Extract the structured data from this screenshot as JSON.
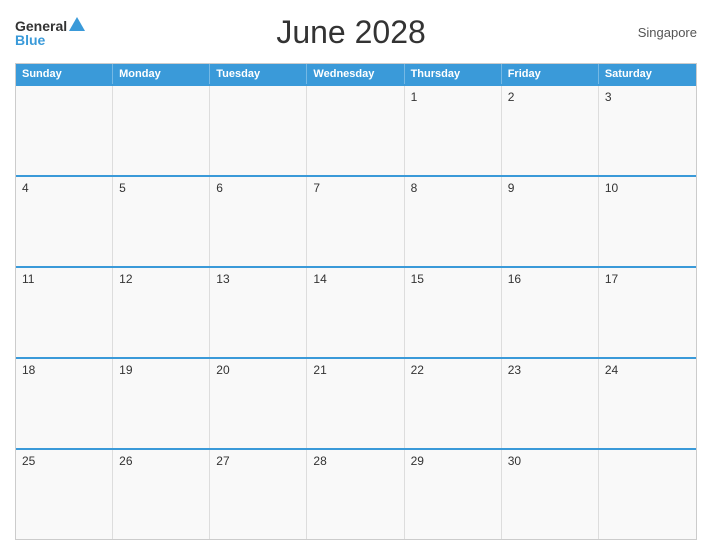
{
  "header": {
    "logo_general": "General",
    "logo_blue": "Blue",
    "title": "June 2028",
    "region": "Singapore"
  },
  "calendar": {
    "days_of_week": [
      "Sunday",
      "Monday",
      "Tuesday",
      "Wednesday",
      "Thursday",
      "Friday",
      "Saturday"
    ],
    "weeks": [
      [
        {
          "day": ""
        },
        {
          "day": ""
        },
        {
          "day": ""
        },
        {
          "day": ""
        },
        {
          "day": "1"
        },
        {
          "day": "2"
        },
        {
          "day": "3"
        }
      ],
      [
        {
          "day": "4"
        },
        {
          "day": "5"
        },
        {
          "day": "6"
        },
        {
          "day": "7"
        },
        {
          "day": "8"
        },
        {
          "day": "9"
        },
        {
          "day": "10"
        }
      ],
      [
        {
          "day": "11"
        },
        {
          "day": "12"
        },
        {
          "day": "13"
        },
        {
          "day": "14"
        },
        {
          "day": "15"
        },
        {
          "day": "16"
        },
        {
          "day": "17"
        }
      ],
      [
        {
          "day": "18"
        },
        {
          "day": "19"
        },
        {
          "day": "20"
        },
        {
          "day": "21"
        },
        {
          "day": "22"
        },
        {
          "day": "23"
        },
        {
          "day": "24"
        }
      ],
      [
        {
          "day": "25"
        },
        {
          "day": "26"
        },
        {
          "day": "27"
        },
        {
          "day": "28"
        },
        {
          "day": "29"
        },
        {
          "day": "30"
        },
        {
          "day": ""
        }
      ]
    ]
  }
}
